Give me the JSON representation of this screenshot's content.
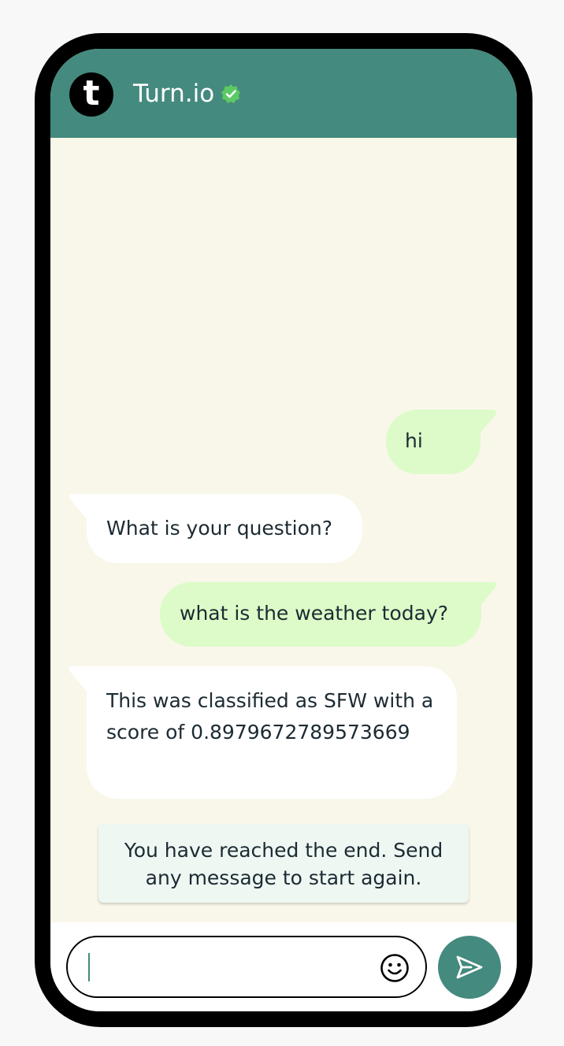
{
  "header": {
    "avatar_letter": "t",
    "title": "Turn.io",
    "verified_icon": "verified-badge-icon",
    "background_color": "#458a7e"
  },
  "messages": [
    {
      "direction": "outgoing",
      "text": "hi"
    },
    {
      "direction": "incoming",
      "text": "What is your question?"
    },
    {
      "direction": "outgoing",
      "text": "what is the weather today?"
    },
    {
      "direction": "incoming",
      "text": "This was classified as SFW with a score of 0.8979672789573669"
    }
  ],
  "end_notice": {
    "line1": "You have reached the end. Send",
    "line2": "any message to start again."
  },
  "composer": {
    "input_value": "",
    "emoji_icon": "smiley-icon",
    "send_icon": "send-icon"
  },
  "colors": {
    "outgoing_bubble": "#dcfbc8",
    "incoming_bubble": "#ffffff",
    "chat_background": "#f9f7ea",
    "accent": "#458a7e"
  }
}
